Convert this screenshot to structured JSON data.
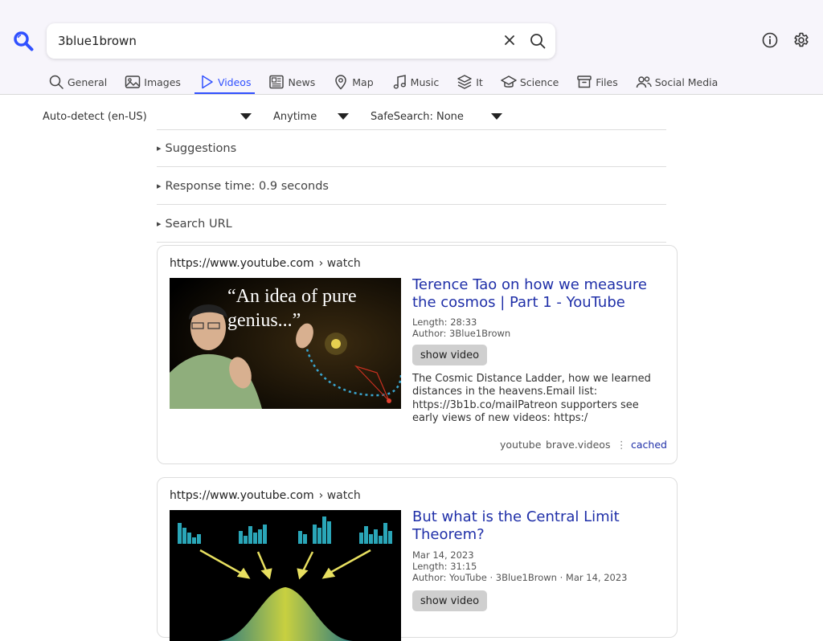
{
  "header": {
    "logo_icon": "search-logo-icon",
    "search_value": "3blue1brown",
    "clear_icon": "close-icon",
    "search_icon": "search-icon",
    "info_icon": "info-icon",
    "settings_icon": "gear-icon",
    "accent_color": "#3050ff"
  },
  "tabs": [
    {
      "label": "General",
      "icon": "magnifier-icon",
      "active": false
    },
    {
      "label": "Images",
      "icon": "image-icon",
      "active": false
    },
    {
      "label": "Videos",
      "icon": "play-icon",
      "active": true
    },
    {
      "label": "News",
      "icon": "newspaper-icon",
      "active": false
    },
    {
      "label": "Map",
      "icon": "map-pin-icon",
      "active": false
    },
    {
      "label": "Music",
      "icon": "music-note-icon",
      "active": false
    },
    {
      "label": "It",
      "icon": "layers-icon",
      "active": false
    },
    {
      "label": "Science",
      "icon": "graduation-cap-icon",
      "active": false
    },
    {
      "label": "Files",
      "icon": "archive-icon",
      "active": false
    },
    {
      "label": "Social Media",
      "icon": "people-icon",
      "active": false
    }
  ],
  "filters": {
    "language": "Auto-detect (en-US)",
    "time": "Anytime",
    "safesearch": "SafeSearch: None"
  },
  "details": {
    "suggestions": "Suggestions",
    "response_time": "Response time: 0.9 seconds",
    "search_url": "Search URL"
  },
  "results": [
    {
      "url": "https://www.youtube.com",
      "crumb": "› watch",
      "title": "Terence Tao on how we measure the cosmos | Part 1 - YouTube",
      "thumb_quote": "“An idea of pure genius...”",
      "length": "Length: 28:33",
      "author": "Author: 3Blue1Brown",
      "show_label": "show video",
      "description": "The Cosmic Distance Ladder, how we learned distances in the heavens.Email list: https://3b1b.co/mailPatreon supporters see early views of new videos: https:/",
      "engine1": "youtube",
      "engine2": "brave.videos",
      "cached": "cached"
    },
    {
      "url": "https://www.youtube.com",
      "crumb": "› watch",
      "title": "But what is the Central Limit Theorem?",
      "date": "Mar 14, 2023",
      "length": "Length: 31:15",
      "author": "Author: YouTube · 3Blue1Brown · Mar 14, 2023",
      "show_label": "show video"
    }
  ]
}
